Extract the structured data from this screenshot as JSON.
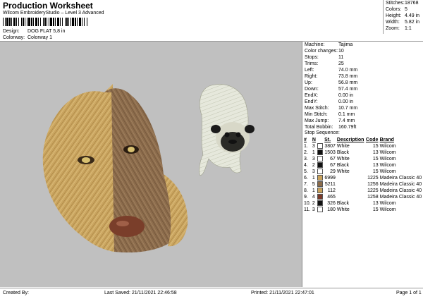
{
  "header": {
    "title": "Production Worksheet",
    "subtitle": "Wilcom EmbroideryStudio – Level 3 Advanced",
    "design_label": "Design:",
    "design_value": "DOG FLAT 5,8 in",
    "colorway_label": "Colorway:",
    "colorway_value": "Colorway 1"
  },
  "stats": [
    {
      "label": "Stitches:",
      "value": "18768"
    },
    {
      "label": "Colors:",
      "value": "5"
    },
    {
      "label": "Height:",
      "value": "4.49 in"
    },
    {
      "label": "Width:",
      "value": "5.82 in"
    },
    {
      "label": "Zoom:",
      "value": "1:1"
    }
  ],
  "info": [
    {
      "label": "Machine:",
      "value": "Tajima"
    },
    {
      "label": "Color changes:",
      "value": "10"
    },
    {
      "label": "Stops:",
      "value": "11"
    },
    {
      "label": "Trims:",
      "value": "25"
    },
    {
      "label": "Left:",
      "value": "74.0 mm"
    },
    {
      "label": "Right:",
      "value": "73.8 mm"
    },
    {
      "label": "Up:",
      "value": "56.8 mm"
    },
    {
      "label": "Down:",
      "value": "57.4 mm"
    },
    {
      "label": "EndX:",
      "value": "0.00 in"
    },
    {
      "label": "EndY:",
      "value": "0.00 in"
    },
    {
      "label": "Max Stitch:",
      "value": "10.7 mm"
    },
    {
      "label": "Min Stitch:",
      "value": "0.1 mm"
    },
    {
      "label": "Max Jump:",
      "value": "7.4 mm"
    },
    {
      "label": "Total Bobbin:",
      "value": "160.79ft"
    }
  ],
  "sequence": {
    "title": "Stop Sequence:",
    "columns": [
      "#",
      "N",
      "",
      "St.",
      "Description",
      "Code",
      "Brand"
    ],
    "rows": [
      {
        "n": "1.",
        "needle": "3",
        "color": "#ffffff",
        "st": "3807",
        "desc": "White",
        "code": "15",
        "brand": "Wilcom"
      },
      {
        "n": "2.",
        "needle": "1",
        "color": "#111111",
        "st": "1503",
        "desc": "Black",
        "code": "13",
        "brand": "Wilcom"
      },
      {
        "n": "3.",
        "needle": "3",
        "color": "#ffffff",
        "st": "67",
        "desc": "White",
        "code": "15",
        "brand": "Wilcom"
      },
      {
        "n": "4.",
        "needle": "2",
        "color": "#111111",
        "st": "67",
        "desc": "Black",
        "code": "13",
        "brand": "Wilcom"
      },
      {
        "n": "5.",
        "needle": "3",
        "color": "#ffffff",
        "st": "29",
        "desc": "White",
        "code": "15",
        "brand": "Wilcom"
      },
      {
        "n": "6.",
        "needle": "1",
        "color": "#c9a25a",
        "st": "6999",
        "desc": "",
        "code": "1225",
        "brand": "Madeira Classic 40"
      },
      {
        "n": "7.",
        "needle": "5",
        "color": "#8a6a48",
        "st": "5211",
        "desc": "",
        "code": "1256",
        "brand": "Madeira Classic 40"
      },
      {
        "n": "8.",
        "needle": "1",
        "color": "#c9a25a",
        "st": "112",
        "desc": "",
        "code": "1225",
        "brand": "Madeira Classic 40"
      },
      {
        "n": "9.",
        "needle": "4",
        "color": "#7a3a2a",
        "st": "465",
        "desc": "",
        "code": "1258",
        "brand": "Madeira Classic 40"
      },
      {
        "n": "10.",
        "needle": "2",
        "color": "#111111",
        "st": "326",
        "desc": "Black",
        "code": "13",
        "brand": "Wilcom"
      },
      {
        "n": "11.",
        "needle": "3",
        "color": "#ffffff",
        "st": "180",
        "desc": "White",
        "code": "15",
        "brand": "Wilcom"
      }
    ]
  },
  "footer": {
    "created_by": "Created By:",
    "last_saved": "Last Saved: 21/11/2021 22:46:58",
    "printed": "Printed: 21/11/2021 22:47:01",
    "page": "Page 1 of 1"
  }
}
